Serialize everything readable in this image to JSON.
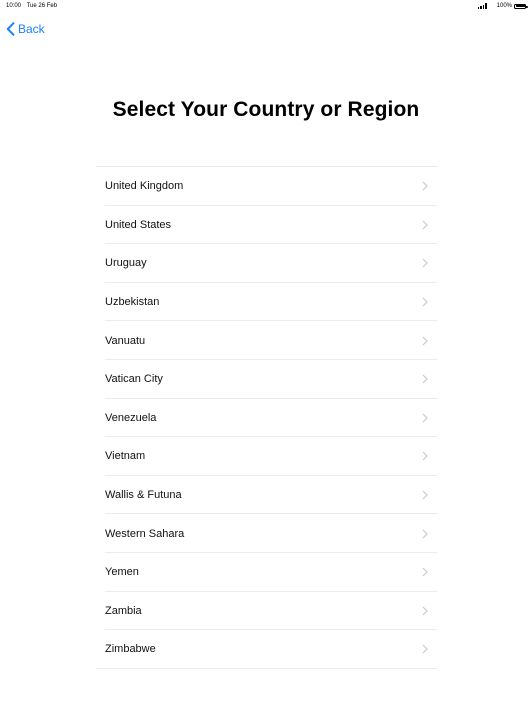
{
  "status_bar": {
    "time": "10:00",
    "date": "Tue 26 Feb",
    "battery": "100%",
    "signal_icon": "signal-bars-icon",
    "battery_icon": "battery-icon"
  },
  "nav": {
    "back_label": "Back",
    "back_icon": "chevron-left-icon"
  },
  "title": "Select Your Country or Region",
  "countries": [
    {
      "label": "United Kingdom"
    },
    {
      "label": "United States"
    },
    {
      "label": "Uruguay"
    },
    {
      "label": "Uzbekistan"
    },
    {
      "label": "Vanuatu"
    },
    {
      "label": "Vatican City"
    },
    {
      "label": "Venezuela"
    },
    {
      "label": "Vietnam"
    },
    {
      "label": "Wallis & Futuna"
    },
    {
      "label": "Western Sahara"
    },
    {
      "label": "Yemen"
    },
    {
      "label": "Zambia"
    },
    {
      "label": "Zimbabwe"
    }
  ],
  "colors": {
    "accent": "#1a82f7",
    "separator": "#ececec",
    "chevron": "#c7c7cc"
  }
}
